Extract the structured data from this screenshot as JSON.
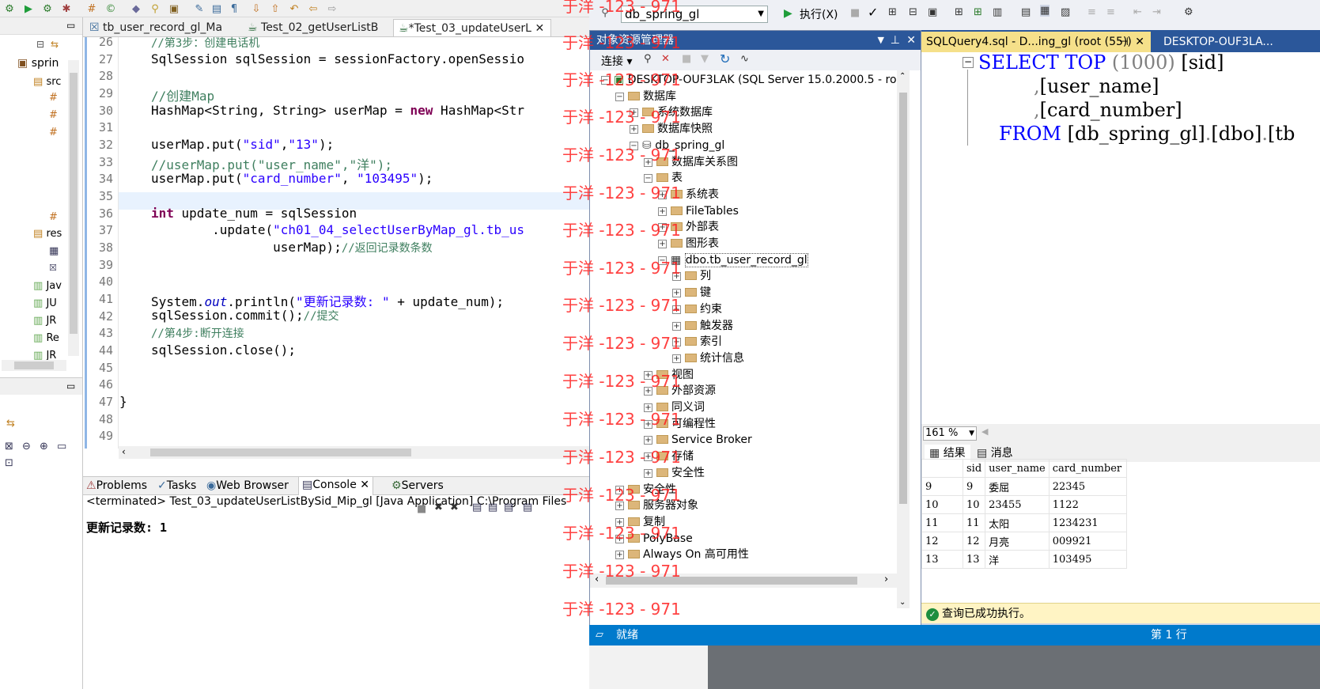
{
  "eclipse": {
    "package_explorer": {
      "items": [
        "sprin",
        "src",
        "res",
        "Jav",
        "JU",
        "JR",
        "Re",
        "JR"
      ]
    },
    "editor_tabs": [
      {
        "label": "tb_user_record_gl_Ma"
      },
      {
        "label": "Test_02_getUserListB"
      },
      {
        "label": "*Test_03_updateUserL"
      }
    ],
    "line_numbers": [
      "26",
      "27",
      "28",
      "29",
      "30",
      "31",
      "32",
      "33",
      "34",
      "35",
      "36",
      "37",
      "38",
      "39",
      "40",
      "41",
      "42",
      "43",
      "44",
      "45",
      "46",
      "47",
      "48",
      "49"
    ],
    "code": {
      "l26": "//第3步：创建电话机",
      "l27a": "SqlSession sqlSession = sessionFactory.openSessio",
      "l29": "//创建Map",
      "l30a": "HashMap<String, String> userMap = ",
      "l30b": "new",
      "l30c": " HashMap<Str",
      "l32a": "userMap.put(",
      "l32b": "\"sid\"",
      "l32c": ",",
      "l32d": "\"13\"",
      "l32e": ");",
      "l33": "//userMap.put(\"user_name\",\"洋\");",
      "l34a": "userMap.put(",
      "l34b": "\"card_number\"",
      "l34c": ", ",
      "l34d": "\"103495\"",
      "l34e": ");",
      "l36a": "int",
      "l36b": " update_num = sqlSession",
      "l37a": "        .update(",
      "l37b": "\"ch01_04_selectUserByMap_gl.tb_us",
      "l38a": "                userMap);",
      "l38b": "//返回记录数条数",
      "l41a": "System.",
      "l41b": "out",
      "l41c": ".println(",
      "l41d": "\"更新记录数: \"",
      "l41e": " + update_num);",
      "l42a": "sqlSession.commit();",
      "l42b": "//提交",
      "l43": "//第4步:断开连接",
      "l44": "sqlSession.close();",
      "l47": "}"
    },
    "console_tabs": [
      {
        "label": "Problems"
      },
      {
        "label": "Tasks"
      },
      {
        "label": "Web Browser"
      },
      {
        "label": "Console"
      },
      {
        "label": "Servers"
      }
    ],
    "console_header": "<terminated> Test_03_updateUserListBySid_Mip_gl [Java Application] C:\\Program Files",
    "console_output": "更新记录数: 1"
  },
  "ssms": {
    "database_selector": "db_spring_gl",
    "execute_label": "执行(X)",
    "object_explorer": {
      "title": "对象资源管理器",
      "connect_label": "连接",
      "tree": [
        {
          "label": "DESKTOP-OUF3LAK (SQL Server 15.0.2000.5 - roo"
        },
        {
          "label": "数据库"
        },
        {
          "label": "系统数据库"
        },
        {
          "label": "数据库快照"
        },
        {
          "label": "db_spring_gl"
        },
        {
          "label": "数据库关系图"
        },
        {
          "label": "表"
        },
        {
          "label": "系统表"
        },
        {
          "label": "FileTables"
        },
        {
          "label": "外部表"
        },
        {
          "label": "图形表"
        },
        {
          "label": "dbo.tb_user_record_gl"
        },
        {
          "label": "列"
        },
        {
          "label": "键"
        },
        {
          "label": "约束"
        },
        {
          "label": "触发器"
        },
        {
          "label": "索引"
        },
        {
          "label": "统计信息"
        },
        {
          "label": "视图"
        },
        {
          "label": "外部资源"
        },
        {
          "label": "同义词"
        },
        {
          "label": "可编程性"
        },
        {
          "label": "Service Broker"
        },
        {
          "label": "存储"
        },
        {
          "label": "安全性"
        },
        {
          "label": "安全性"
        },
        {
          "label": "服务器对象"
        },
        {
          "label": "复制"
        },
        {
          "label": "PolyBase"
        },
        {
          "label": "Always On 高可用性"
        }
      ]
    },
    "watermark": "于洋 -123 - 971",
    "query_tabs": [
      {
        "label": "SQLQuery4.sql - D...ing_gl (root (55))"
      },
      {
        "label": "DESKTOP-OUF3LA..."
      }
    ],
    "sql": {
      "l1a": "SELECT",
      "l1b": "TOP",
      "l1c": "(1000)",
      "l1d": "[sid]",
      "l2a": ",",
      "l2b": "[user_name]",
      "l3a": ",",
      "l3b": "[card_number]",
      "l4a": "FROM",
      "l4b": "[db_spring_gl]",
      "l4c": ".",
      "l4d": "[dbo]",
      "l4e": ".",
      "l4f": "[tb"
    },
    "zoom": "161 %",
    "result_tabs": [
      {
        "label": "结果"
      },
      {
        "label": "消息"
      }
    ],
    "grid": {
      "columns": [
        "sid",
        "user_name",
        "card_number"
      ],
      "rows": [
        [
          "9",
          "9",
          "委屈",
          "22345"
        ],
        [
          "10",
          "10",
          "23455",
          "1122"
        ],
        [
          "11",
          "11",
          "太阳",
          "1234231"
        ],
        [
          "12",
          "12",
          "月亮",
          "009921"
        ],
        [
          "13",
          "13",
          "洋",
          "103495"
        ]
      ]
    },
    "query_status": "查询已成功执行。",
    "status_bar": {
      "left": "就绪",
      "right": "第 1 行"
    }
  }
}
